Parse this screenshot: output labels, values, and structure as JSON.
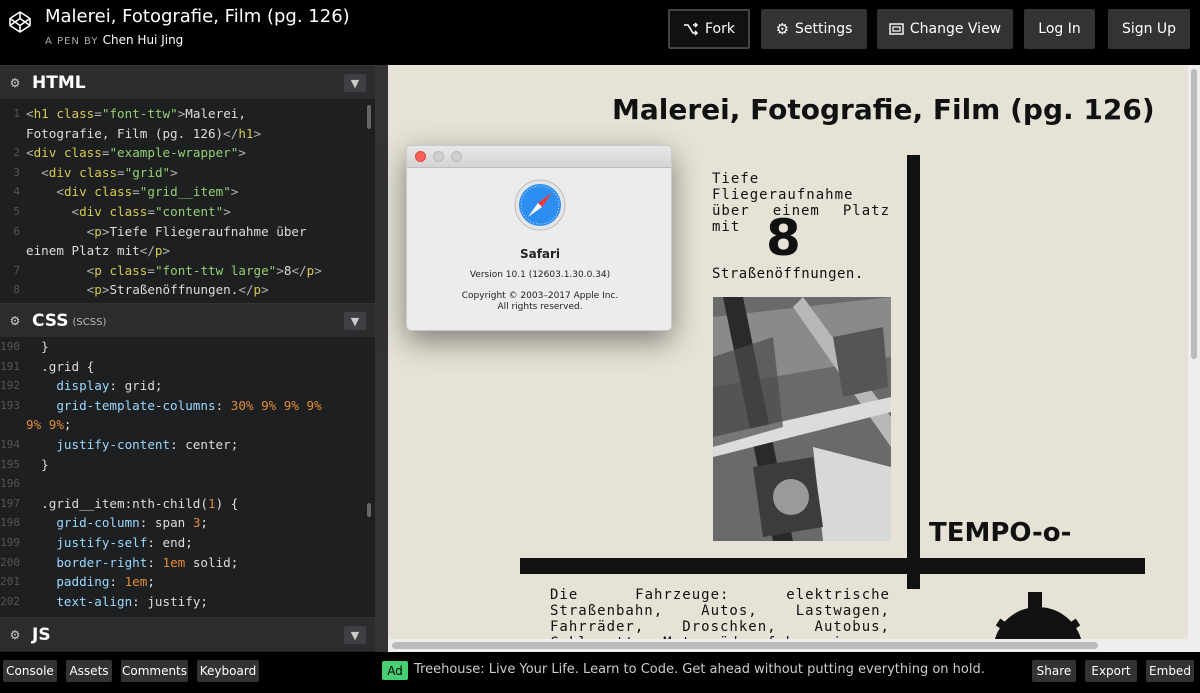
{
  "header": {
    "title": "Malerei, Fotografie, Film (pg. 126)",
    "by_label": "A PEN BY",
    "author": "Chen Hui Jing",
    "buttons": {
      "fork": "Fork",
      "settings": "Settings",
      "change_view": "Change View",
      "login": "Log In",
      "signup": "Sign Up"
    }
  },
  "html_editor": {
    "label": "HTML",
    "lines": [
      {
        "n": "1",
        "parts": [
          [
            "t",
            "<"
          ],
          [
            "tg",
            "h1 "
          ],
          [
            "at",
            "class"
          ],
          [
            "t",
            "="
          ],
          [
            "str",
            "\"font-ttw\""
          ],
          [
            "t",
            ">"
          ],
          [
            "txt",
            "Malerei,"
          ]
        ]
      },
      {
        "n": "",
        "parts": [
          [
            "txt",
            "Fotografie, Film (pg. 126)"
          ],
          [
            "t",
            "</"
          ],
          [
            "tg",
            "h1"
          ],
          [
            "t",
            ">"
          ]
        ]
      },
      {
        "n": "2",
        "parts": [
          [
            "t",
            "<"
          ],
          [
            "tg",
            "div "
          ],
          [
            "at",
            "class"
          ],
          [
            "t",
            "="
          ],
          [
            "str",
            "\"example-wrapper\""
          ],
          [
            "t",
            ">"
          ]
        ]
      },
      {
        "n": "3",
        "parts": [
          [
            "txt",
            "  "
          ],
          [
            "t",
            "<"
          ],
          [
            "tg",
            "div "
          ],
          [
            "at",
            "class"
          ],
          [
            "t",
            "="
          ],
          [
            "str",
            "\"grid\""
          ],
          [
            "t",
            ">"
          ]
        ]
      },
      {
        "n": "4",
        "parts": [
          [
            "txt",
            "    "
          ],
          [
            "t",
            "<"
          ],
          [
            "tg",
            "div "
          ],
          [
            "at",
            "class"
          ],
          [
            "t",
            "="
          ],
          [
            "str",
            "\"grid__item\""
          ],
          [
            "t",
            ">"
          ]
        ]
      },
      {
        "n": "5",
        "parts": [
          [
            "txt",
            "      "
          ],
          [
            "t",
            "<"
          ],
          [
            "tg",
            "div "
          ],
          [
            "at",
            "class"
          ],
          [
            "t",
            "="
          ],
          [
            "str",
            "\"content\""
          ],
          [
            "t",
            ">"
          ]
        ]
      },
      {
        "n": "6",
        "parts": [
          [
            "txt",
            "        "
          ],
          [
            "t",
            "<"
          ],
          [
            "tg",
            "p"
          ],
          [
            "t",
            ">"
          ],
          [
            "txt",
            "Tiefe Fliegeraufnahme über"
          ]
        ]
      },
      {
        "n": "",
        "parts": [
          [
            "txt",
            "einem Platz mit"
          ],
          [
            "t",
            "</"
          ],
          [
            "tg",
            "p"
          ],
          [
            "t",
            ">"
          ]
        ]
      },
      {
        "n": "7",
        "parts": [
          [
            "txt",
            "        "
          ],
          [
            "t",
            "<"
          ],
          [
            "tg",
            "p "
          ],
          [
            "at",
            "class"
          ],
          [
            "t",
            "="
          ],
          [
            "str",
            "\"font-ttw large\""
          ],
          [
            "t",
            ">"
          ],
          [
            "txt",
            "8"
          ],
          [
            "t",
            "</"
          ],
          [
            "tg",
            "p"
          ],
          [
            "t",
            ">"
          ]
        ]
      },
      {
        "n": "8",
        "parts": [
          [
            "txt",
            "        "
          ],
          [
            "t",
            "<"
          ],
          [
            "tg",
            "p"
          ],
          [
            "t",
            ">"
          ],
          [
            "txt",
            "Straßenöffnungen."
          ],
          [
            "t",
            "</"
          ],
          [
            "tg",
            "p"
          ],
          [
            "t",
            ">"
          ]
        ]
      }
    ]
  },
  "css_editor": {
    "label": "CSS",
    "sublabel": "(SCSS)",
    "lines": [
      {
        "n": "190",
        "parts": [
          [
            "txt",
            "  }"
          ]
        ]
      },
      {
        "n": "191",
        "parts": [
          [
            "sel",
            "  .grid {"
          ]
        ]
      },
      {
        "n": "192",
        "parts": [
          [
            "prop",
            "    display"
          ],
          [
            "val",
            ": grid;"
          ]
        ]
      },
      {
        "n": "193",
        "parts": [
          [
            "prop",
            "    grid-template-columns"
          ],
          [
            "val",
            ": "
          ],
          [
            "num",
            "30% 9% 9% 9%"
          ]
        ]
      },
      {
        "n": "",
        "parts": [
          [
            "num",
            "9% 9%"
          ],
          [
            "val",
            ";"
          ]
        ]
      },
      {
        "n": "194",
        "parts": [
          [
            "prop",
            "    justify-content"
          ],
          [
            "val",
            ": center;"
          ]
        ]
      },
      {
        "n": "195",
        "parts": [
          [
            "txt",
            "  }"
          ]
        ]
      },
      {
        "n": "196",
        "parts": [
          [
            "txt",
            ""
          ]
        ]
      },
      {
        "n": "197",
        "parts": [
          [
            "sel",
            "  .grid__item:nth-child("
          ],
          [
            "num",
            "1"
          ],
          [
            "sel",
            ") {"
          ]
        ]
      },
      {
        "n": "198",
        "parts": [
          [
            "prop",
            "    grid-column"
          ],
          [
            "val",
            ": span "
          ],
          [
            "num",
            "3"
          ],
          [
            "val",
            ";"
          ]
        ]
      },
      {
        "n": "199",
        "parts": [
          [
            "prop",
            "    justify-self"
          ],
          [
            "val",
            ": end;"
          ]
        ]
      },
      {
        "n": "200",
        "parts": [
          [
            "prop",
            "    border-right"
          ],
          [
            "val",
            ": "
          ],
          [
            "num",
            "1em"
          ],
          [
            "val",
            " solid;"
          ]
        ]
      },
      {
        "n": "201",
        "parts": [
          [
            "prop",
            "    padding"
          ],
          [
            "val",
            ": "
          ],
          [
            "num",
            "1em"
          ],
          [
            "val",
            ";"
          ]
        ]
      },
      {
        "n": "202",
        "parts": [
          [
            "prop",
            "    text-align"
          ],
          [
            "val",
            ": justify;"
          ]
        ]
      }
    ]
  },
  "js_editor": {
    "label": "JS"
  },
  "preview": {
    "title": "Malerei, Fotografie, Film (pg. 126)",
    "p1": "Tiefe Fliegeraufnahme über einem Platz mit",
    "large": "8",
    "p2": "Straßenöffnungen.",
    "tempo": "TEMPO-o-",
    "p3": "Die Fahrzeuge: elektrische Straßenbahn, Autos, Lastwagen, Fahrräder, Droschken, Autobus, Cyklonette. Motorräder fahren in"
  },
  "dialog": {
    "app": "Safari",
    "version": "Version 10.1 (12603.1.30.0.34)",
    "copyright": "Copyright © 2003–2017 Apple Inc.",
    "rights": "All rights reserved."
  },
  "footer": {
    "console": "Console",
    "assets": "Assets",
    "comments": "Comments",
    "keyboard": "Keyboard",
    "ad_badge": "Ad",
    "ad_text": "Treehouse: Live Your Life. Learn to Code. Get ahead without putting everything on hold.",
    "share": "Share",
    "export": "Export",
    "embed": "Embed"
  },
  "colors": {
    "accent_green": "#47cf73",
    "preview_bg": "#e6e3d6"
  }
}
